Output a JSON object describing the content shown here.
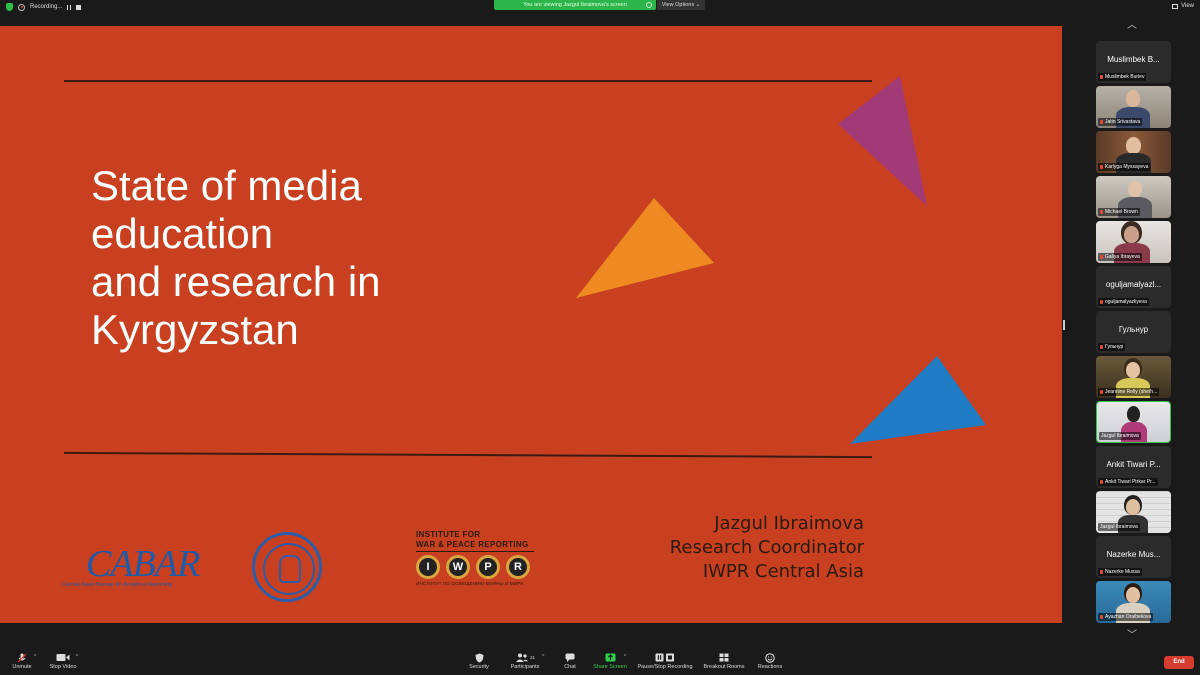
{
  "topbar": {
    "recording_label": "Recording...",
    "viewing_banner": "You are viewing Jazgul Ibraimova's screen",
    "view_options": "View Options",
    "view_label": "View"
  },
  "slide": {
    "title_lines": [
      "State of media",
      "education",
      "and research in",
      "Kyrgyzstan"
    ],
    "presenter": {
      "name": "Jazgul Ibraimova",
      "role": "Research Coordinator",
      "org": "IWPR Central Asia"
    },
    "logos": {
      "cabar_word": "CABAR",
      "cabar_sub": "Central Asian Bureau for Analytical Reporting",
      "iwpr_top_1": "INSTITUTE FOR",
      "iwpr_top_2": "WAR & PEACE REPORTING",
      "iwpr_keys": [
        "I",
        "W",
        "P",
        "R"
      ],
      "iwpr_bottom": "ИНСТИТУТ ПО ОСВЕЩЕНИЮ ВОЙНЫ И МИРА"
    },
    "colors": {
      "background": "#c8401f",
      "magenta": "#a33a78",
      "orange": "#ef8a22",
      "blue": "#1e7bc4"
    }
  },
  "participants": [
    {
      "big": "Muslimbek B...",
      "label": "Muslimbek Buriev",
      "video": false
    },
    {
      "big": "",
      "label": "Jatin Srivastava",
      "video": true
    },
    {
      "big": "",
      "label": "Karlyga Myssayeva",
      "video": true
    },
    {
      "big": "",
      "label": "Michael Brown",
      "video": true
    },
    {
      "big": "",
      "label": "Galiya Ibrayeva",
      "video": true
    },
    {
      "big": "oguljamalyazl...",
      "label": "oguljamalyazliyeva",
      "video": false
    },
    {
      "big": "Гульнур",
      "label": "Гульнур",
      "video": false
    },
    {
      "big": "",
      "label": "Jeannine Relly (she/h...",
      "video": true
    },
    {
      "big": "",
      "label": "Jazgul Ibraimova",
      "video": true,
      "active": true
    },
    {
      "big": "Ankit Tiwari P...",
      "label": "Ankit Tiwari Ptrkar Pr...",
      "video": false
    },
    {
      "big": "",
      "label": "Jazgul Ibraimova",
      "video": true
    },
    {
      "big": "Nazerke Mus...",
      "label": "Nazerke Mussa",
      "video": false
    },
    {
      "big": "",
      "label": "Ayazhan Oralbekova",
      "video": true
    }
  ],
  "toolbar": {
    "unmute": "Unmute",
    "stop_video": "Stop Video",
    "security": "Security",
    "participants": "Participants",
    "participants_count": "21",
    "chat": "Chat",
    "share_screen": "Share Screen",
    "pause_recording": "Pause/Stop Recording",
    "breakout_rooms": "Breakout Rooms",
    "reactions": "Reactions",
    "end": "End"
  }
}
